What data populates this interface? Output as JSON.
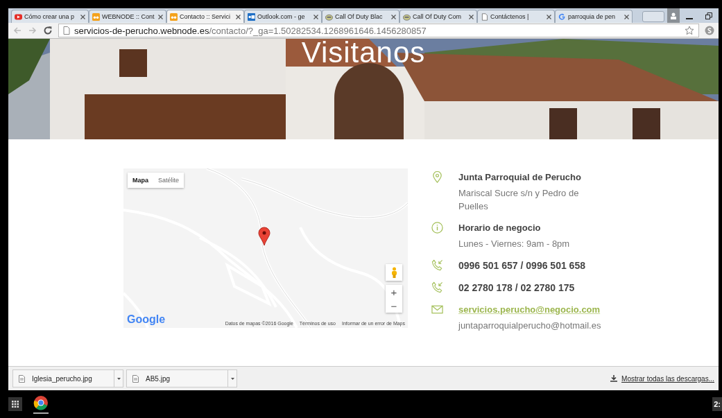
{
  "tabs": [
    {
      "kind": "video",
      "title": "Cómo crear una p",
      "selected": false
    },
    {
      "kind": "site",
      "title": "WEBNODE :: Cont",
      "selected": false
    },
    {
      "kind": "site",
      "title": "Contacto :: Servici",
      "selected": true
    },
    {
      "kind": "mail",
      "title": "Outlook.com - ge",
      "selected": false
    },
    {
      "kind": "game",
      "title": "Call Of Duty Blac",
      "selected": false
    },
    {
      "kind": "game",
      "title": "Call Of Duty Com",
      "selected": false
    },
    {
      "kind": "page",
      "title": "Contáctenos |",
      "selected": false
    },
    {
      "kind": "search",
      "title": "parroquia de pen",
      "selected": false
    }
  ],
  "address": {
    "host": "servicios-de-perucho.webnode.es",
    "path": "/contacto/?_ga=1.50282534.1268961646.1456280857"
  },
  "hero": {
    "title": "Visitanos"
  },
  "map": {
    "map_types": [
      {
        "label": "Mapa",
        "selected": true
      },
      {
        "label": "Satélite",
        "selected": false
      }
    ],
    "zoom_in": "+",
    "zoom_out": "−",
    "logo": "Google",
    "footer": [
      "Datos de mapas ©2016 Google",
      "Términos de uso",
      "Informar de un error de Maps"
    ]
  },
  "contacts": [
    {
      "kind": "location",
      "title": "Junta Parroquial de Perucho",
      "lines": [
        "Mariscal Sucre s/n y Pedro de Puelles"
      ]
    },
    {
      "kind": "info",
      "title": "Horario de negocio",
      "lines": [
        "Lunes - Viernes: 9am - 8pm"
      ]
    },
    {
      "kind": "phone",
      "title": "0996 501 657 / 0996 501 658"
    },
    {
      "kind": "phone",
      "title": "02 2780 178 / 02 2780 175"
    },
    {
      "kind": "email",
      "title": "servicios.perucho@negocio.com",
      "lines": [
        "juntaparroquialperucho@hotmail.es"
      ]
    }
  ],
  "downloads": {
    "items": [
      {
        "name": "Iglesia_perucho.jpg"
      },
      {
        "name": "AB5.jpg"
      }
    ],
    "show_all": "Mostrar todas las descargas..."
  },
  "taskbar": {
    "clock": "2:"
  }
}
